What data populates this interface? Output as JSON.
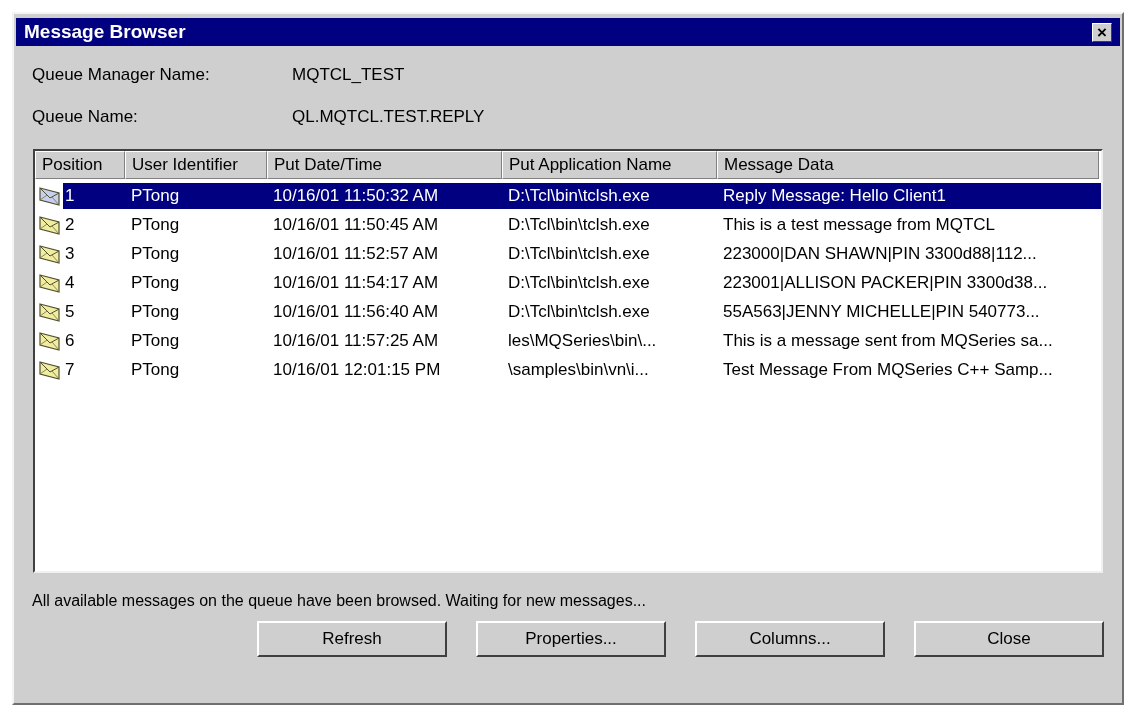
{
  "window": {
    "title": "Message Browser",
    "close": "×"
  },
  "fields": [
    {
      "label": "Queue Manager Name:",
      "value": "MQTCL_TEST"
    },
    {
      "label": "Queue Name:",
      "value": "QL.MQTCL.TEST.REPLY"
    }
  ],
  "table": {
    "columns": [
      "Position",
      "User Identifier",
      "Put Date/Time",
      "Put Application Name",
      "Message Data"
    ],
    "rows": [
      {
        "selected": true,
        "cells": [
          "1",
          "PTong",
          "10/16/01 11:50:32 AM",
          "D:\\Tcl\\bin\\tclsh.exe",
          "Reply Message: Hello Client1"
        ]
      },
      {
        "selected": false,
        "cells": [
          "2",
          "PTong",
          "10/16/01 11:50:45 AM",
          "D:\\Tcl\\bin\\tclsh.exe",
          "This is a test message from MQTCL"
        ]
      },
      {
        "selected": false,
        "cells": [
          "3",
          "PTong",
          "10/16/01 11:52:57 AM",
          "D:\\Tcl\\bin\\tclsh.exe",
          "223000|DAN SHAWN|PIN 3300d88|112..."
        ]
      },
      {
        "selected": false,
        "cells": [
          "4",
          "PTong",
          "10/16/01 11:54:17 AM",
          "D:\\Tcl\\bin\\tclsh.exe",
          "223001|ALLISON PACKER|PIN 3300d38..."
        ]
      },
      {
        "selected": false,
        "cells": [
          "5",
          "PTong",
          "10/16/01 11:56:40 AM",
          "D:\\Tcl\\bin\\tclsh.exe",
          "55A563|JENNY MICHELLE|PIN 540773..."
        ]
      },
      {
        "selected": false,
        "cells": [
          "6",
          "PTong",
          "10/16/01 11:57:25 AM",
          "les\\MQSeries\\bin\\...",
          "This is a message sent from MQSeries sa..."
        ]
      },
      {
        "selected": false,
        "cells": [
          "7",
          "PTong",
          "10/16/01 12:01:15 PM",
          "\\samples\\bin\\vn\\i...",
          "Test Message From MQSeries C++ Samp..."
        ]
      }
    ]
  },
  "status": "All available messages on the queue have been browsed. Waiting for new messages...",
  "buttons": [
    "Refresh",
    "Properties...",
    "Columns...",
    "Close"
  ]
}
